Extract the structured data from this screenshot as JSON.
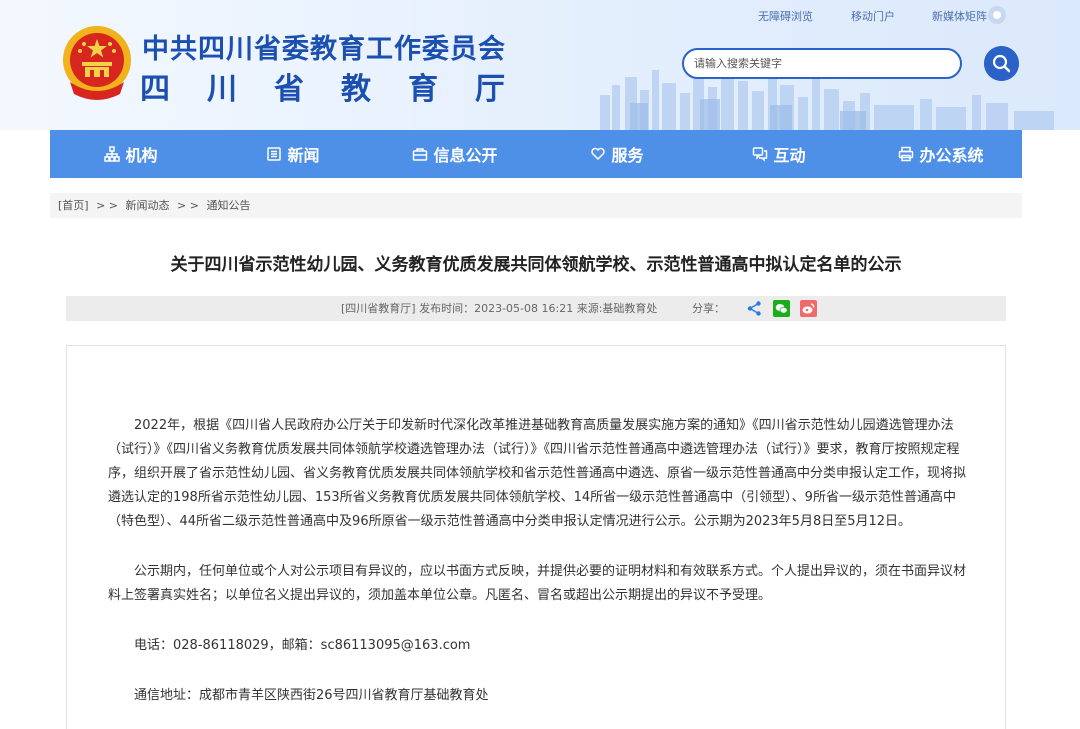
{
  "header": {
    "title_main": "中共四川省委教育工作委员会",
    "title_sub": "四川省教育厅",
    "top_links": {
      "accessible": "无障碍浏览",
      "mobile": "移动门户",
      "media": "新媒体矩阵"
    },
    "search": {
      "placeholder": "请输入搜索关键字"
    },
    "brand_color": "#1b4fb0",
    "accent_color": "#4e8fe8"
  },
  "nav": {
    "items": [
      {
        "label": "机构",
        "icon": "org-chart-icon"
      },
      {
        "label": "新闻",
        "icon": "news-icon"
      },
      {
        "label": "信息公开",
        "icon": "info-open-icon"
      },
      {
        "label": "服务",
        "icon": "heart-hand-icon"
      },
      {
        "label": "互动",
        "icon": "chat-icon"
      },
      {
        "label": "办公系统",
        "icon": "printer-icon"
      }
    ]
  },
  "breadcrumb": {
    "home": "[首页]",
    "sep": "> >",
    "level1": "新闻动态",
    "level2": "通知公告"
  },
  "article": {
    "title": "关于四川省示范性幼儿园、义务教育优质发展共同体领航学校、示范性普通高中拟认定名单的公示",
    "meta": "[四川省教育厅]   发布时间：2023-05-08 16:21   来源:基础教育处",
    "share_label": "分享：",
    "share_icons": [
      "share-icon",
      "wechat-icon",
      "weibo-icon"
    ],
    "paragraphs": [
      "2022年，根据《四川省人民政府办公厅关于印发新时代深化改革推进基础教育高质量发展实施方案的通知》《四川省示范性幼儿园遴选管理办法（试行）》《四川省义务教育优质发展共同体领航学校遴选管理办法（试行）》《四川省示范性普通高中遴选管理办法（试行）》要求，教育厅按照规定程序，组织开展了省示范性幼儿园、省义务教育优质发展共同体领航学校和省示范性普通高中遴选、原省一级示范性普通高中分类申报认定工作，现将拟遴选认定的198所省示范性幼儿园、153所省义务教育优质发展共同体领航学校、14所省一级示范性普通高中（引领型）、9所省一级示范性普通高中（特色型）、44所省二级示范性普通高中及96所原省一级示范性普通高中分类申报认定情况进行公示。公示期为2023年5月8日至5月12日。",
      "公示期内，任何单位或个人对公示项目有异议的，应以书面方式反映，并提供必要的证明材料和有效联系方式。个人提出异议的，须在书面异议材料上签署真实姓名；以单位名义提出异议的，须加盖本单位公章。凡匿名、冒名或超出公示期提出的异议不予受理。",
      "电话：028-86118029，邮箱：sc86113095@163.com",
      "通信地址：成都市青羊区陕西街26号四川省教育厅基础教育处"
    ]
  }
}
